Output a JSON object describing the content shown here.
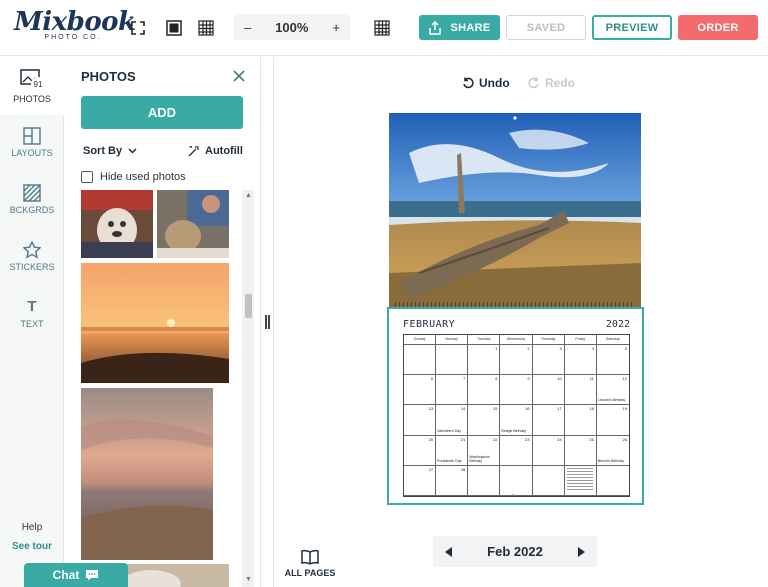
{
  "brand": {
    "name": "Mixbook",
    "tagline": "PHOTO CO."
  },
  "toolbar": {
    "zoom_minus": "–",
    "zoom_value": "100%",
    "zoom_plus": "+",
    "share_label": "SHARE",
    "saved_label": "SAVED",
    "preview_label": "PREVIEW",
    "order_label": "ORDER"
  },
  "leftnav": {
    "items": [
      {
        "label": "PHOTOS",
        "badge": "91"
      },
      {
        "label": "LAYOUTS"
      },
      {
        "label": "BCKGRDS"
      },
      {
        "label": "STICKERS"
      },
      {
        "label": "TEXT",
        "glyph": "T"
      }
    ],
    "help": "Help",
    "tour": "See tour",
    "chat": "Chat"
  },
  "panel": {
    "title": "PHOTOS",
    "add_label": "ADD",
    "sort_label": "Sort By",
    "autofill_label": "Autofill",
    "hide_used_label": "Hide used photos"
  },
  "history": {
    "undo": "Undo",
    "redo": "Redo"
  },
  "calendar": {
    "month": "FEBRUARY",
    "year": "2022",
    "days": [
      "Sunday",
      "Monday",
      "Tuesday",
      "Wednesday",
      "Thursday",
      "Friday",
      "Saturday"
    ],
    "dates": [
      "",
      "",
      "1",
      "2",
      "3",
      "4",
      "5",
      "6",
      "7",
      "8",
      "9",
      "10",
      "11",
      "12",
      "13",
      "14",
      "15",
      "16",
      "17",
      "18",
      "19",
      "20",
      "21",
      "22",
      "23",
      "24",
      "25",
      "26",
      "27",
      "28",
      "",
      "",
      "",
      "",
      ""
    ],
    "events": {
      "12": "Lincoln's Birthday",
      "14": "Valentine's Day",
      "16": "Beagle Birthday",
      "21": "Presidents' Day",
      "22": "Washington's Birthday",
      "26": "Bench's Birthday"
    }
  },
  "footer": {
    "all_pages": "ALL PAGES",
    "page_label": "Feb 2022"
  },
  "colors": {
    "accent": "#3aaba4",
    "order": "#f46a6d",
    "navy": "#1d3557"
  }
}
